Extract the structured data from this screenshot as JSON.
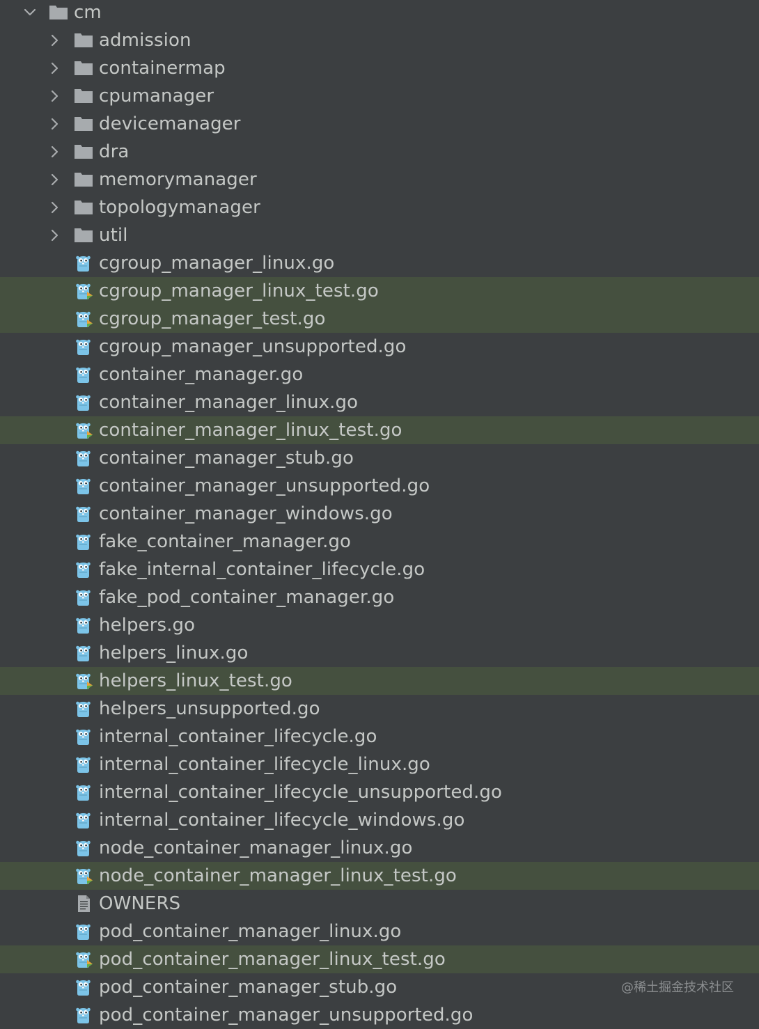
{
  "tree": {
    "root": {
      "label": "cm",
      "expanded": true,
      "icon": "folder-icon"
    },
    "folders": [
      {
        "label": "admission"
      },
      {
        "label": "containermap"
      },
      {
        "label": "cpumanager"
      },
      {
        "label": "devicemanager"
      },
      {
        "label": "dra"
      },
      {
        "label": "memorymanager"
      },
      {
        "label": "topologymanager"
      },
      {
        "label": "util"
      }
    ],
    "files": [
      {
        "label": "cgroup_manager_linux.go",
        "type": "go",
        "test": false
      },
      {
        "label": "cgroup_manager_linux_test.go",
        "type": "go",
        "test": true
      },
      {
        "label": "cgroup_manager_test.go",
        "type": "go",
        "test": true
      },
      {
        "label": "cgroup_manager_unsupported.go",
        "type": "go",
        "test": false
      },
      {
        "label": "container_manager.go",
        "type": "go",
        "test": false
      },
      {
        "label": "container_manager_linux.go",
        "type": "go",
        "test": false
      },
      {
        "label": "container_manager_linux_test.go",
        "type": "go",
        "test": true
      },
      {
        "label": "container_manager_stub.go",
        "type": "go",
        "test": false
      },
      {
        "label": "container_manager_unsupported.go",
        "type": "go",
        "test": false
      },
      {
        "label": "container_manager_windows.go",
        "type": "go",
        "test": false
      },
      {
        "label": "fake_container_manager.go",
        "type": "go",
        "test": false
      },
      {
        "label": "fake_internal_container_lifecycle.go",
        "type": "go",
        "test": false
      },
      {
        "label": "fake_pod_container_manager.go",
        "type": "go",
        "test": false
      },
      {
        "label": "helpers.go",
        "type": "go",
        "test": false
      },
      {
        "label": "helpers_linux.go",
        "type": "go",
        "test": false
      },
      {
        "label": "helpers_linux_test.go",
        "type": "go",
        "test": true
      },
      {
        "label": "helpers_unsupported.go",
        "type": "go",
        "test": false
      },
      {
        "label": "internal_container_lifecycle.go",
        "type": "go",
        "test": false
      },
      {
        "label": "internal_container_lifecycle_linux.go",
        "type": "go",
        "test": false
      },
      {
        "label": "internal_container_lifecycle_unsupported.go",
        "type": "go",
        "test": false
      },
      {
        "label": "internal_container_lifecycle_windows.go",
        "type": "go",
        "test": false
      },
      {
        "label": "node_container_manager_linux.go",
        "type": "go",
        "test": false
      },
      {
        "label": "node_container_manager_linux_test.go",
        "type": "go",
        "test": true
      },
      {
        "label": "OWNERS",
        "type": "text",
        "test": false
      },
      {
        "label": "pod_container_manager_linux.go",
        "type": "go",
        "test": false
      },
      {
        "label": "pod_container_manager_linux_test.go",
        "type": "go",
        "test": true
      },
      {
        "label": "pod_container_manager_stub.go",
        "type": "go",
        "test": false
      },
      {
        "label": "pod_container_manager_unsupported.go",
        "type": "go",
        "test": false
      }
    ]
  },
  "watermark": "@稀土掘金技术社区",
  "colors": {
    "background": "#3c3f41",
    "test_row_background": "#45503f",
    "text": "#c5c8c6",
    "folder": "#a7abae",
    "gopher": "#7cc4e8",
    "test_marker": "#e8a33b"
  }
}
